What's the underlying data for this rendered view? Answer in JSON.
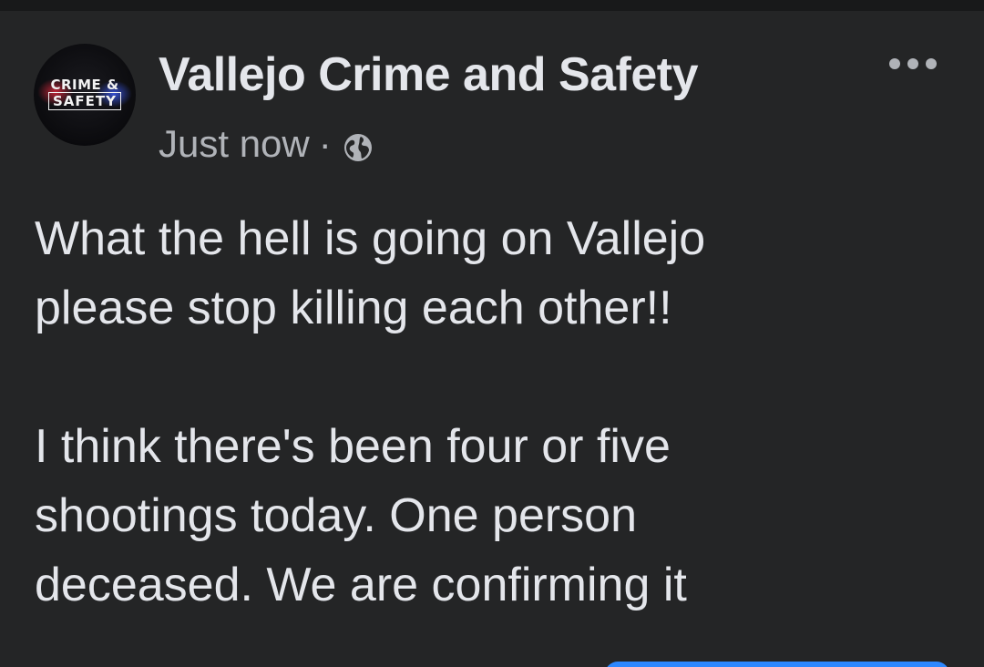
{
  "post": {
    "page_name": "Vallejo Crime and Safety",
    "timestamp": "Just now",
    "separator": "·",
    "audience_icon": "globe-icon",
    "more_icon": "more-options-icon",
    "avatar": {
      "logo_line1": "CRIME & ",
      "logo_line2": "SAFETY"
    },
    "paragraphs": [
      "What the hell is going on Vallejo\nplease stop killing each other!!",
      "I think there's been four or five\nshootings today. One person\ndeceased. We are confirming it"
    ]
  },
  "colors": {
    "background": "#242526",
    "text_primary": "#e4e6eb",
    "text_secondary": "#b0b3b8",
    "accent_button": "#2d88ff"
  }
}
